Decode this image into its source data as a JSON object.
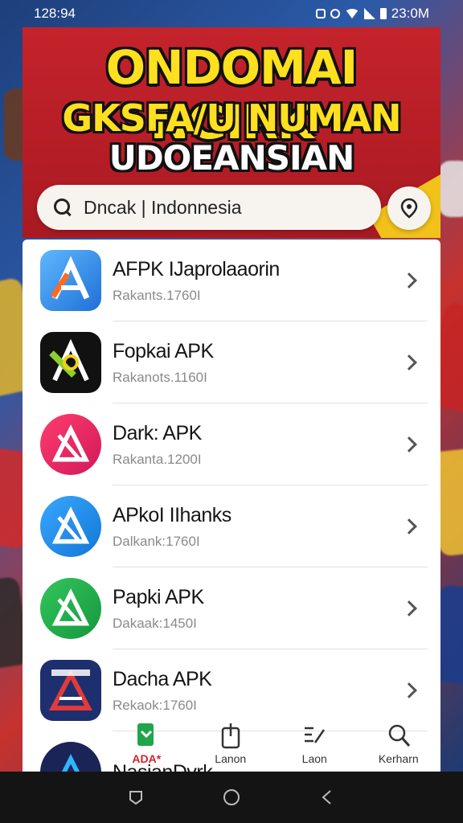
{
  "status_bar": {
    "time_left": "128:94",
    "time_right": "23:0M"
  },
  "header": {
    "title_line1": "ONDOMAI NGIRK",
    "title_line2": "GKSFA/U NUMAN",
    "title_line3": "UDOEANSIAN"
  },
  "search": {
    "text": "Dncak | Indonnesia"
  },
  "apps": [
    {
      "name": "AFPK IJaprolaaorin",
      "sub": "Rakants.1760I",
      "icon": "a-logo-blue"
    },
    {
      "name": "Fopkai APK",
      "sub": "Rakanots.1160I",
      "icon": "a-logo-green-black"
    },
    {
      "name": "Dark: APK",
      "sub": "Rakanta.1200I",
      "icon": "a-logo-pink"
    },
    {
      "name": "APkoI IIhanks",
      "sub": "Dalkank:1760I",
      "icon": "a-logo-blue-round"
    },
    {
      "name": "Papki APK",
      "sub": "Dakaak:1450I",
      "icon": "a-logo-green"
    },
    {
      "name": "Dacha APK",
      "sub": "Rekaok:1760I",
      "icon": "a-logo-navy"
    },
    {
      "name": "NasianDvrk",
      "sub": "",
      "icon": "a-logo-dark-round"
    }
  ],
  "tabs": [
    {
      "label": "ADA*",
      "icon": "apk-flag-icon"
    },
    {
      "label": "Lanon",
      "icon": "share-icon"
    },
    {
      "label": "Laon",
      "icon": "edit-list-icon"
    },
    {
      "label": "Kerharn",
      "icon": "search-icon"
    }
  ],
  "colors": {
    "banner_red": "#c4232b",
    "title_yellow": "#ffe01f",
    "accent_green": "#1fa64a",
    "accent_blue": "#1f8be0",
    "accent_pink": "#e8226c"
  }
}
